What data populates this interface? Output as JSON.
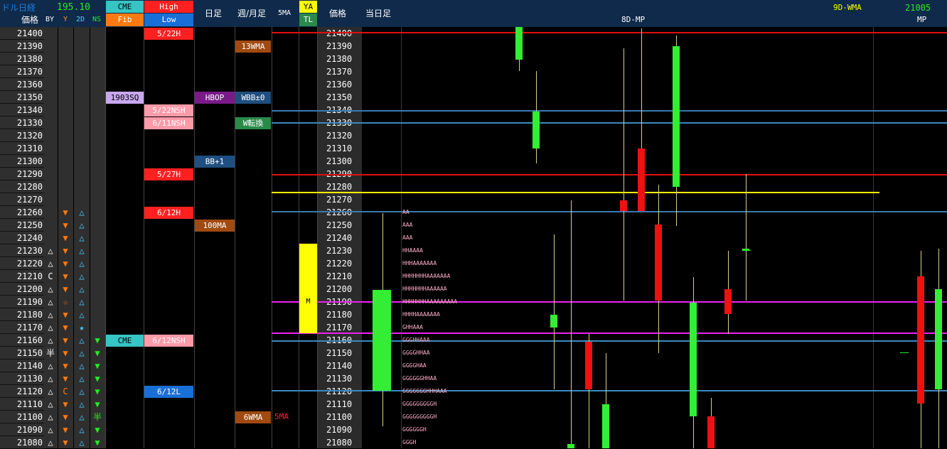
{
  "header": {
    "title": "ドル日経",
    "value": "195.10",
    "price_label": "価格",
    "by": "BY",
    "y": "Y",
    "two_d": "2D",
    "ns": "NS",
    "cme": "CME",
    "fib": "Fib",
    "high": "High",
    "low": "Low",
    "daily": "日足",
    "weekly_monthly": "週/月足",
    "five_ma": "5MA",
    "ya": "YA",
    "tl": "TL",
    "price2": "価格",
    "today": "当日足",
    "eight_d_mp": "8D-MP",
    "nine_d_wma": "9D-WMA",
    "wma_value": "21005",
    "mp": "MP"
  },
  "prices": [
    21400,
    21390,
    21380,
    21370,
    21360,
    21350,
    21340,
    21330,
    21320,
    21310,
    21300,
    21290,
    21280,
    21270,
    21260,
    21250,
    21240,
    21230,
    21220,
    21210,
    21200,
    21190,
    21180,
    21170,
    21160,
    21150,
    21140,
    21130,
    21120,
    21110,
    21100,
    21090,
    21080
  ],
  "by_marks": [
    {
      "row": 17,
      "t": "△"
    },
    {
      "row": 18,
      "t": "△"
    },
    {
      "row": 19,
      "t": "C"
    },
    {
      "row": 20,
      "t": "△"
    },
    {
      "row": 21,
      "t": "△"
    },
    {
      "row": 22,
      "t": "△"
    },
    {
      "row": 23,
      "t": "△"
    },
    {
      "row": 24,
      "t": "△"
    },
    {
      "row": 25,
      "t": "半"
    },
    {
      "row": 26,
      "t": "△"
    },
    {
      "row": 27,
      "t": "△"
    },
    {
      "row": 28,
      "t": "△"
    },
    {
      "row": 29,
      "t": "△"
    },
    {
      "row": 30,
      "t": "△"
    },
    {
      "row": 31,
      "t": "△"
    },
    {
      "row": 32,
      "t": "△"
    }
  ],
  "y_marks": [
    {
      "row": 14,
      "t": "▼"
    },
    {
      "row": 15,
      "t": "▼"
    },
    {
      "row": 16,
      "t": "▼"
    },
    {
      "row": 17,
      "t": "▼"
    },
    {
      "row": 18,
      "t": "▼"
    },
    {
      "row": 19,
      "t": "▼"
    },
    {
      "row": 20,
      "t": "▼"
    },
    {
      "row": 21,
      "t": "☆"
    },
    {
      "row": 22,
      "t": "▼"
    },
    {
      "row": 23,
      "t": "▼"
    },
    {
      "row": 24,
      "t": "▼"
    },
    {
      "row": 25,
      "t": "▼"
    },
    {
      "row": 26,
      "t": "▼"
    },
    {
      "row": 27,
      "t": "▼"
    },
    {
      "row": 28,
      "t": "C"
    },
    {
      "row": 29,
      "t": "▼"
    },
    {
      "row": 30,
      "t": "▼"
    },
    {
      "row": 31,
      "t": "▼"
    },
    {
      "row": 32,
      "t": "▼"
    }
  ],
  "twod_marks": [
    {
      "row": 14,
      "t": "△"
    },
    {
      "row": 15,
      "t": "△"
    },
    {
      "row": 16,
      "t": "△"
    },
    {
      "row": 17,
      "t": "△"
    },
    {
      "row": 18,
      "t": "△"
    },
    {
      "row": 19,
      "t": "△"
    },
    {
      "row": 20,
      "t": "△"
    },
    {
      "row": 21,
      "t": "△"
    },
    {
      "row": 22,
      "t": "△"
    },
    {
      "row": 23,
      "t": "★"
    },
    {
      "row": 24,
      "t": "△"
    },
    {
      "row": 25,
      "t": "△"
    },
    {
      "row": 26,
      "t": "△"
    },
    {
      "row": 27,
      "t": "△"
    },
    {
      "row": 28,
      "t": "△"
    },
    {
      "row": 29,
      "t": "△"
    },
    {
      "row": 30,
      "t": "△"
    },
    {
      "row": 31,
      "t": "△"
    },
    {
      "row": 32,
      "t": "△"
    }
  ],
  "ns_marks": [
    {
      "row": 24,
      "t": "▼"
    },
    {
      "row": 25,
      "t": "▼"
    },
    {
      "row": 26,
      "t": "▼"
    },
    {
      "row": 27,
      "t": "▼"
    },
    {
      "row": 28,
      "t": "▼"
    },
    {
      "row": 29,
      "t": "▼"
    },
    {
      "row": 30,
      "t": "半"
    },
    {
      "row": 31,
      "t": "▼"
    },
    {
      "row": 32,
      "t": "▼"
    }
  ],
  "cme_tags": [
    {
      "row": 5,
      "text": "1903SQ",
      "bg": "#c9a8f0",
      "fg": "#000"
    },
    {
      "row": 24,
      "text": "CME",
      "bg": "#36c4c4",
      "fg": "#000"
    }
  ],
  "highlow_tags": [
    {
      "row": 0,
      "text": "5/22H",
      "bg": "#ff2020",
      "fg": "#fff"
    },
    {
      "row": 6,
      "text": "5/22NSH",
      "bg": "#ff9aa8",
      "fg": "#fff"
    },
    {
      "row": 7,
      "text": "6/11NSH",
      "bg": "#ff9aa8",
      "fg": "#fff"
    },
    {
      "row": 11,
      "text": "5/27H",
      "bg": "#ff2020",
      "fg": "#fff"
    },
    {
      "row": 14,
      "text": "6/12H",
      "bg": "#ff2020",
      "fg": "#fff"
    },
    {
      "row": 24,
      "text": "6/12NSH",
      "bg": "#ff9aa8",
      "fg": "#fff"
    },
    {
      "row": 28,
      "text": "6/12L",
      "bg": "#1a6fd6",
      "fg": "#fff"
    }
  ],
  "daily_tags": [
    {
      "row": 5,
      "text": "HBOP",
      "bg": "#7a1a8a",
      "fg": "#fff"
    },
    {
      "row": 10,
      "text": "BB+1",
      "bg": "#1f4f80",
      "fg": "#fff"
    },
    {
      "row": 15,
      "text": "100MA",
      "bg": "#a04a10",
      "fg": "#fff"
    }
  ],
  "wm_tags": [
    {
      "row": 1,
      "text": "13WMA",
      "bg": "#a04a10",
      "fg": "#fff"
    },
    {
      "row": 5,
      "text": "WBB±0",
      "bg": "#1f4f80",
      "fg": "#fff"
    },
    {
      "row": 7,
      "text": "W転換",
      "bg": "#2a8a4a",
      "fg": "#fff"
    },
    {
      "row": 30,
      "text": "6WMA",
      "bg": "#a04a10",
      "fg": "#fff"
    }
  ],
  "five_ma_tag": {
    "row": 30,
    "text": "5MA"
  },
  "ya_marker": {
    "row": 21,
    "text": "M"
  },
  "tpo_rows": [
    {
      "row": 14,
      "t": "AA"
    },
    {
      "row": 15,
      "t": "AAA"
    },
    {
      "row": 16,
      "t": "AAA"
    },
    {
      "row": 17,
      "t": "HHAAAA"
    },
    {
      "row": 18,
      "t": "HHHAAAAAAA"
    },
    {
      "row": 19,
      "t": "HHHHHHHAAAAAAA"
    },
    {
      "row": 20,
      "t": "HHHHHHHAAAAAA"
    },
    {
      "row": 21,
      "t": "HHHHHHHAAAAAAAAA"
    },
    {
      "row": 22,
      "t": "HHHHAAAAAAA"
    },
    {
      "row": 23,
      "t": "GHHAAA"
    },
    {
      "row": 24,
      "t": "GGGHHAAA"
    },
    {
      "row": 25,
      "t": "GGGGHHAA"
    },
    {
      "row": 26,
      "t": "GGGGHAA"
    },
    {
      "row": 27,
      "t": "GGGGGGHHAA"
    },
    {
      "row": 28,
      "t": "GGGGGGGHHHAAA"
    },
    {
      "row": 29,
      "t": "GGGGGGGGGH"
    },
    {
      "row": 30,
      "t": "GGGGGGGGGH"
    },
    {
      "row": 31,
      "t": "GGGGGGH"
    },
    {
      "row": 32,
      "t": "GGGH"
    }
  ],
  "colors": {
    "header_bg": "#0f2a4a",
    "up": "#33ee33",
    "down": "#ee1111",
    "title_blue": "#1e7fe0",
    "value_green": "#22ee22",
    "wma_yellow": "#ffff00",
    "ya_yellow": "#ffff00",
    "triangle_orange": "#ff7a10",
    "triangle_cyan": "#4ad0ff",
    "triangle_green": "#22ee22"
  }
}
